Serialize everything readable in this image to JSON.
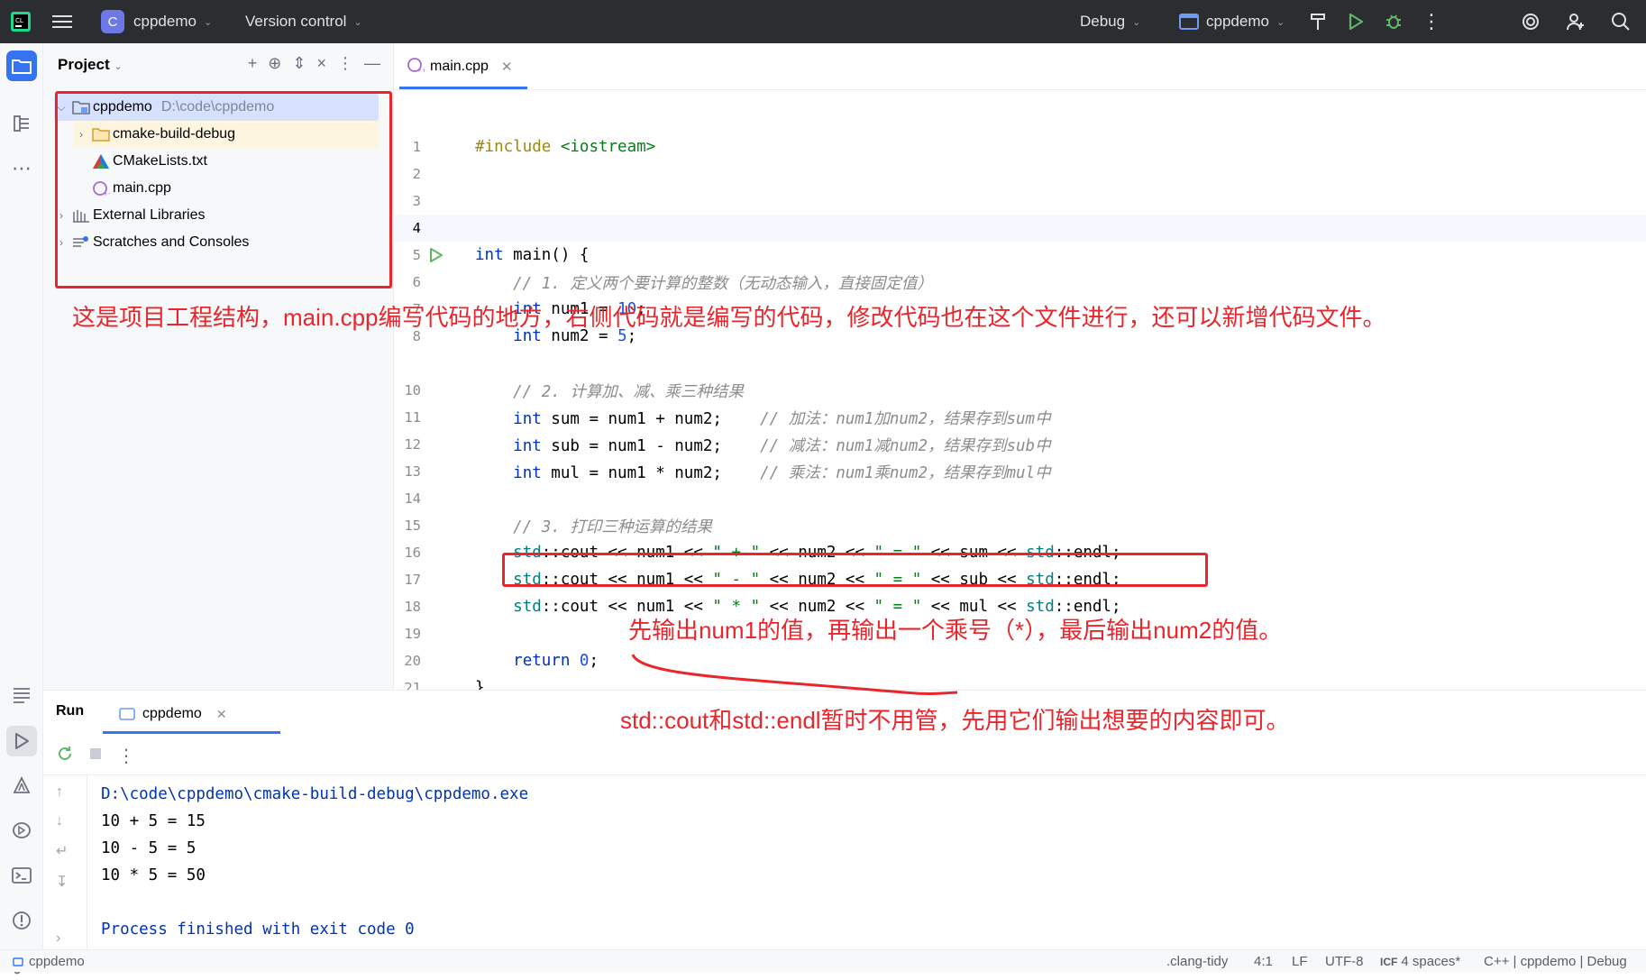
{
  "titlebar": {
    "project_name": "cppdemo",
    "project_initial": "C",
    "vcs_label": "Version control",
    "config": "Debug",
    "run_target": "cppdemo"
  },
  "project_panel": {
    "title": "Project",
    "tree": [
      {
        "label": "cppdemo",
        "path": "D:\\code\\cppdemo"
      },
      {
        "label": "cmake-build-debug"
      },
      {
        "label": "CMakeLists.txt"
      },
      {
        "label": "main.cpp"
      },
      {
        "label": "External Libraries"
      },
      {
        "label": "Scratches and Consoles"
      }
    ]
  },
  "editor": {
    "tab_label": "main.cpp",
    "line_numbers": [
      "1",
      "2",
      "3",
      "4",
      "5",
      "6",
      "7",
      "8",
      "10",
      "11",
      "12",
      "13",
      "14",
      "15",
      "16",
      "17",
      "18",
      "19",
      "20",
      "21"
    ]
  },
  "run_panel": {
    "title": "Run",
    "tab_label": "cppdemo",
    "output": [
      "D:\\code\\cppdemo\\cmake-build-debug\\cppdemo.exe",
      "10 + 5 = 15",
      "10 - 5 = 5",
      "10 * 5 = 50",
      "",
      "Process finished with exit code 0"
    ]
  },
  "statusbar": {
    "project": "cppdemo",
    "clang_tidy": ".clang-tidy",
    "position": "4:1",
    "line_ending": "LF",
    "encoding": "UTF-8",
    "indent": "4 spaces*",
    "context": "C++ | cppdemo | Debug"
  },
  "annotations": {
    "project_note": "这是项目工程结构，main.cpp编写代码的地方，右侧代码就是编写的代码，修改代码也在这个文件进行，还可以新增代码文件。",
    "mul_note": "先输出num1的值，再输出一个乘号（*），最后输出num2的值。",
    "cout_note": "std::cout和std::endl暂时不用管，先用它们输出想要的内容即可。"
  },
  "colors": {
    "accent": "#3574f0",
    "annotation_red": "#e8262b",
    "keyword": "#0033b3",
    "string": "#067d17",
    "comment": "#8c8c8c"
  }
}
